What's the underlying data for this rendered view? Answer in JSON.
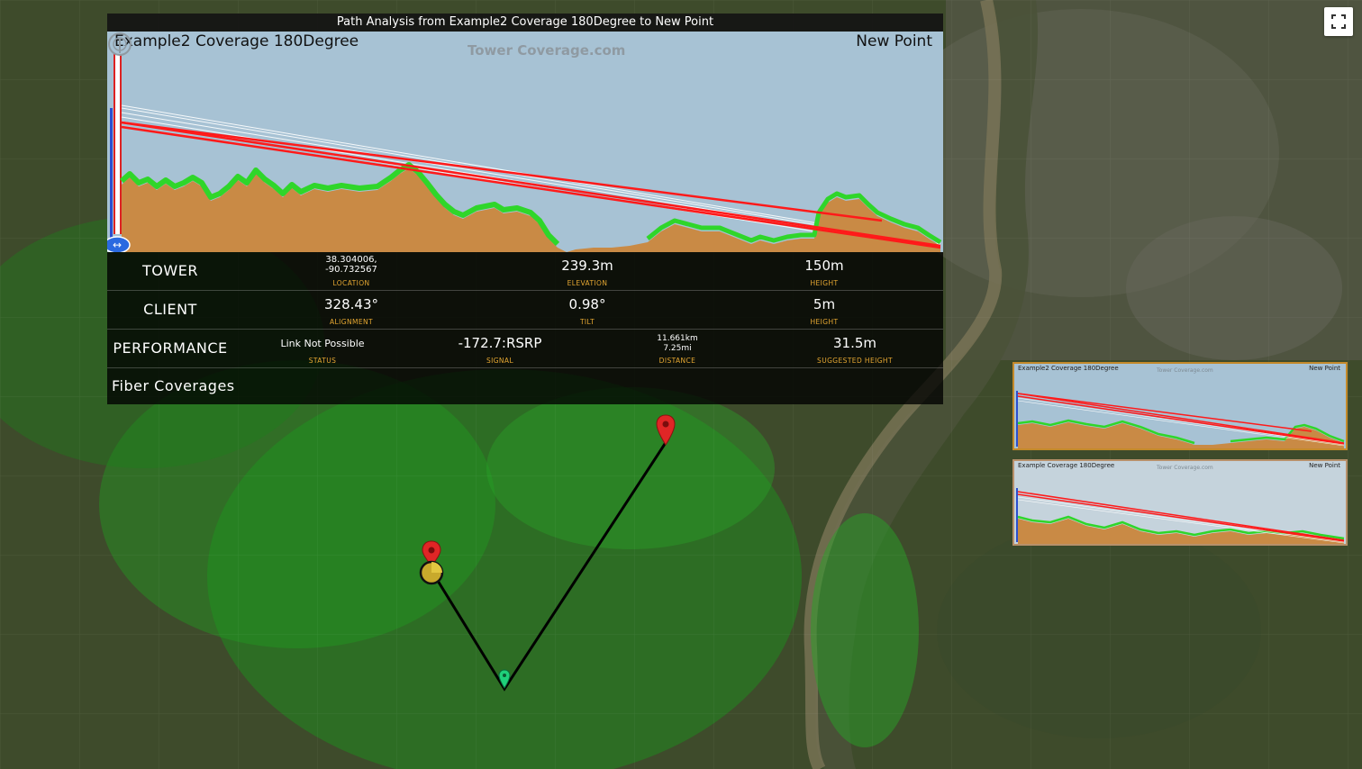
{
  "panel": {
    "title": "Path Analysis from Example2 Coverage 180Degree to New Point",
    "from_label": "Example2 Coverage 180Degree",
    "to_label": "New Point",
    "watermark": "Tower Coverage.com"
  },
  "rows": {
    "tower": {
      "label": "TOWER",
      "location": "38.304006, -90.732567",
      "location_key": "LOCATION",
      "elevation": "239.3m",
      "elevation_key": "ELEVATION",
      "height": "150m",
      "height_key": "HEIGHT"
    },
    "client": {
      "label": "CLIENT",
      "alignment": "328.43°",
      "alignment_key": "ALIGNMENT",
      "tilt": "0.98°",
      "tilt_key": "TILT",
      "height": "5m",
      "height_key": "HEIGHT"
    },
    "performance": {
      "label": "PERFORMANCE",
      "status": "Link Not Possible",
      "status_key": "STATUS",
      "signal": "-172.7:RSRP",
      "signal_key": "SIGNAL",
      "distance_km": "11.661km",
      "distance_mi": "7.25mi",
      "distance_key": "DISTANCE",
      "suggested_height": "31.5m",
      "suggested_height_key": "SUGGESTED HEIGHT"
    },
    "fiber": {
      "label": "Fiber Coverages"
    }
  },
  "thumbnails": [
    {
      "from": "Example2 Coverage 180Degree",
      "to": "New Point",
      "watermark": "Tower Coverage.com"
    },
    {
      "from": "Example Coverage 180Degree",
      "to": "New Point",
      "watermark": "Tower Coverage.com"
    }
  ],
  "colors": {
    "sky": "#a7c2d4",
    "terrain": "#c98a45",
    "vegetation": "#2fd62a",
    "line_of_sight": "#ff1a1a",
    "label_accent": "#e5a732"
  },
  "icons": {
    "fullscreen": "fullscreen-icon",
    "drag_handle": "drag-handle-icon",
    "watermark": "tower-logo-icon",
    "client_marker": "red-map-pin-icon",
    "tower_marker": "green-map-pin-icon",
    "site_marker": "yellow-circle-marker-icon"
  }
}
